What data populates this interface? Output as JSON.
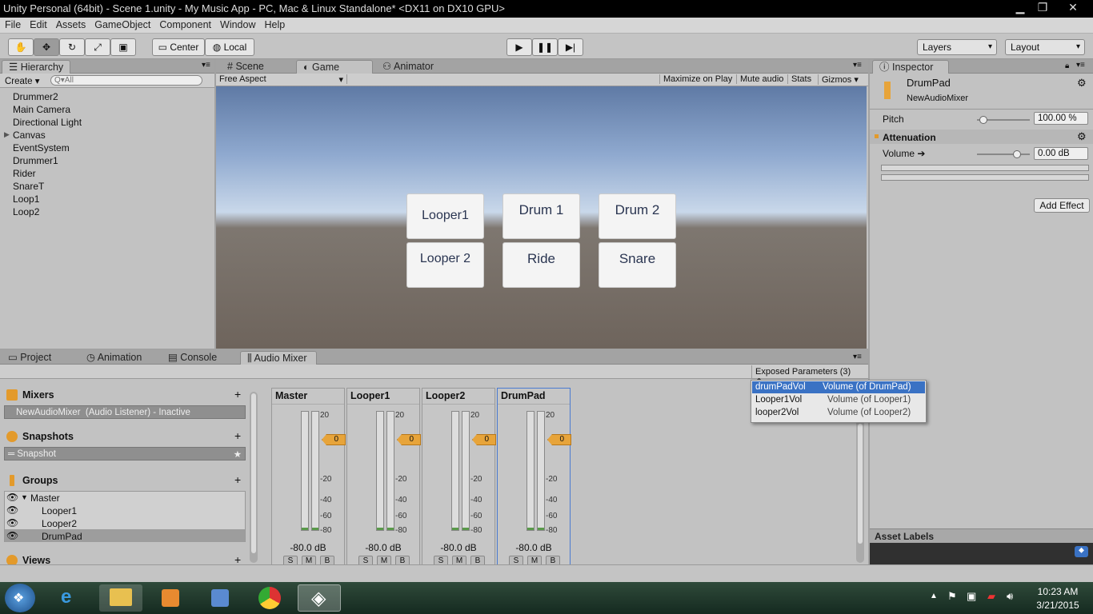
{
  "window": {
    "title": "Unity Personal (64bit) - Scene 1.unity - My Music App - PC, Mac & Linux Standalone* <DX11 on DX10 GPU>"
  },
  "menu": [
    "File",
    "Edit",
    "Assets",
    "GameObject",
    "Component",
    "Window",
    "Help"
  ],
  "toolbar": {
    "center": "Center",
    "local": "Local",
    "layers": "Layers",
    "layout": "Layout"
  },
  "hierarchy": {
    "tab": "Hierarchy",
    "create": "Create",
    "search_placeholder": "Q▾All",
    "items": [
      "Drummer2",
      "Main Camera",
      "Directional Light",
      "Canvas",
      "EventSystem",
      "Drummer1",
      "Rider",
      "SnareT",
      "Loop1",
      "Loop2"
    ]
  },
  "view_tabs": {
    "scene": "Scene",
    "game": "Game",
    "animator": "Animator"
  },
  "game_bar": {
    "aspect": "Free Aspect",
    "maximize": "Maximize on Play",
    "mute": "Mute audio",
    "stats": "Stats",
    "gizmos": "Gizmos"
  },
  "game_buttons": [
    "Looper1",
    "Drum 1",
    "Drum 2",
    "Looper 2",
    "Ride",
    "Snare"
  ],
  "inspector": {
    "tab": "Inspector",
    "name": "DrumPad",
    "subtitle": "NewAudioMixer",
    "pitch_label": "Pitch",
    "pitch_value": "100.00 %",
    "pitch_level": 0.05,
    "attenuation": "Attenuation",
    "volume_label": "Volume ➔",
    "volume_value": "0.00 dB",
    "volume_level": 0.8,
    "add_effect": "Add Effect",
    "asset_labels": "Asset Labels"
  },
  "bottom_tabs": {
    "project": "Project",
    "animation": "Animation",
    "console": "Console",
    "audio_mixer": "Audio Mixer"
  },
  "exposed": {
    "label": "Exposed Parameters (3)",
    "items": [
      {
        "name": "drumPadVol",
        "desc": "Volume (of DrumPad)"
      },
      {
        "name": "Looper1Vol",
        "desc": "Volume (of Looper1)"
      },
      {
        "name": "looper2Vol",
        "desc": "Volume (of Looper2)"
      }
    ]
  },
  "mixers": {
    "label": "Mixers",
    "item": "NewAudioMixer",
    "item_note": "(Audio Listener) - Inactive"
  },
  "snapshots": {
    "label": "Snapshots",
    "item": "Snapshot"
  },
  "groups": {
    "label": "Groups",
    "items": [
      "Master",
      "Looper1",
      "Looper2",
      "DrumPad"
    ]
  },
  "views": {
    "label": "Views"
  },
  "strips": [
    {
      "name": "Master",
      "db": "-80.0 dB"
    },
    {
      "name": "Looper1",
      "db": "-80.0 dB"
    },
    {
      "name": "Looper2",
      "db": "-80.0 dB"
    },
    {
      "name": "DrumPad",
      "db": "-80.0 dB"
    }
  ],
  "strip_scale": [
    "20",
    "0",
    "-20",
    "-40",
    "-60",
    "-80"
  ],
  "fader_value": "0",
  "smb": [
    "S",
    "M",
    "B"
  ],
  "clock": {
    "time": "10:23 AM",
    "date": "3/21/2015"
  },
  "colors": {
    "accent": "#e39a2b",
    "selection": "#3a72c4"
  }
}
